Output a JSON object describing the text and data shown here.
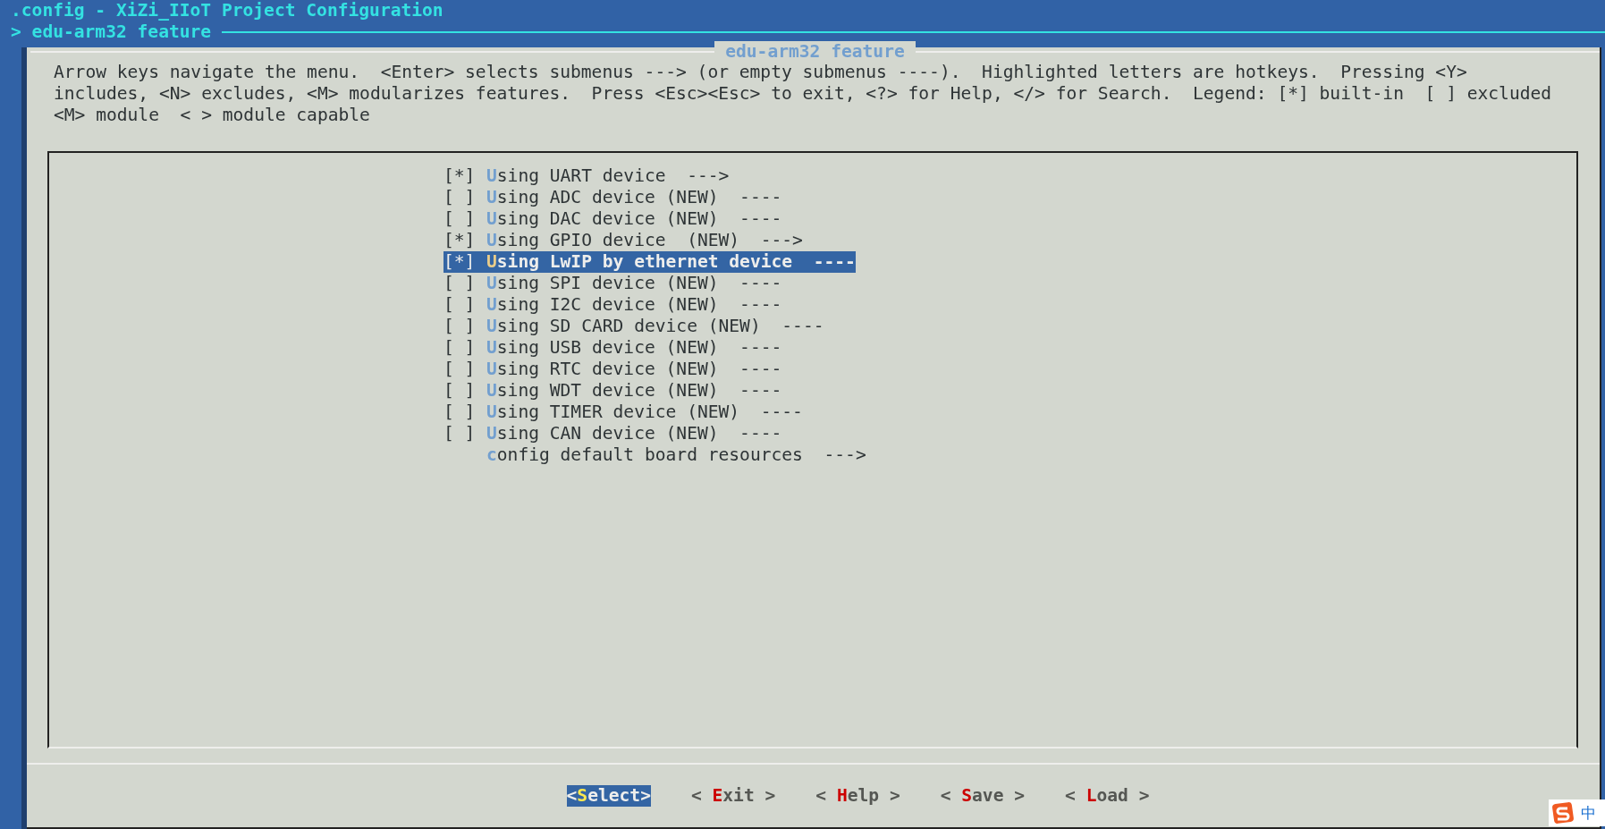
{
  "window": {
    "title": ".config - XiZi_IIoT Project Configuration"
  },
  "breadcrumb": "> edu-arm32 feature",
  "dialog": {
    "title": "edu-arm32 feature",
    "help": [
      "Arrow keys navigate the menu.  <Enter> selects submenus ---> (or empty submenus ----).  Highlighted letters are hotkeys.  Pressing <Y>",
      "includes, <N> excludes, <M> modularizes features.  Press <Esc><Esc> to exit, <?> for Help, </> for Search.  Legend: [*] built-in  [ ] excluded",
      "<M> module  < > module capable"
    ],
    "items": [
      {
        "kind": "bool",
        "box": "[*]",
        "label": "Using UART device  --->",
        "selected": false
      },
      {
        "kind": "bool",
        "box": "[ ]",
        "label": "Using ADC device (NEW)  ----",
        "selected": false
      },
      {
        "kind": "bool",
        "box": "[ ]",
        "label": "Using DAC device (NEW)  ----",
        "selected": false
      },
      {
        "kind": "bool",
        "box": "[*]",
        "label": "Using GPIO device  (NEW)  --->",
        "selected": false
      },
      {
        "kind": "bool",
        "box": "[*]",
        "label": "Using LwIP by ethernet device  ----",
        "selected": true
      },
      {
        "kind": "bool",
        "box": "[ ]",
        "label": "Using SPI device (NEW)  ----",
        "selected": false
      },
      {
        "kind": "bool",
        "box": "[ ]",
        "label": "Using I2C device (NEW)  ----",
        "selected": false
      },
      {
        "kind": "bool",
        "box": "[ ]",
        "label": "Using SD CARD device (NEW)  ----",
        "selected": false
      },
      {
        "kind": "bool",
        "box": "[ ]",
        "label": "Using USB device (NEW)  ----",
        "selected": false
      },
      {
        "kind": "bool",
        "box": "[ ]",
        "label": "Using RTC device (NEW)  ----",
        "selected": false
      },
      {
        "kind": "bool",
        "box": "[ ]",
        "label": "Using WDT device (NEW)  ----",
        "selected": false
      },
      {
        "kind": "bool",
        "box": "[ ]",
        "label": "Using TIMER device (NEW)  ----",
        "selected": false
      },
      {
        "kind": "bool",
        "box": "[ ]",
        "label": "Using CAN device (NEW)  ----",
        "selected": false
      },
      {
        "kind": "menu",
        "label": "config default board resources  --->",
        "selected": false
      }
    ],
    "buttons": [
      {
        "label": "<Select>",
        "selected": true
      },
      {
        "label": "< Exit >",
        "selected": false
      },
      {
        "label": "< Help >",
        "selected": false
      },
      {
        "label": "< Save >",
        "selected": false
      },
      {
        "label": "< Load >",
        "selected": false
      }
    ]
  },
  "ime_toolbar": {
    "mode": "中"
  }
}
